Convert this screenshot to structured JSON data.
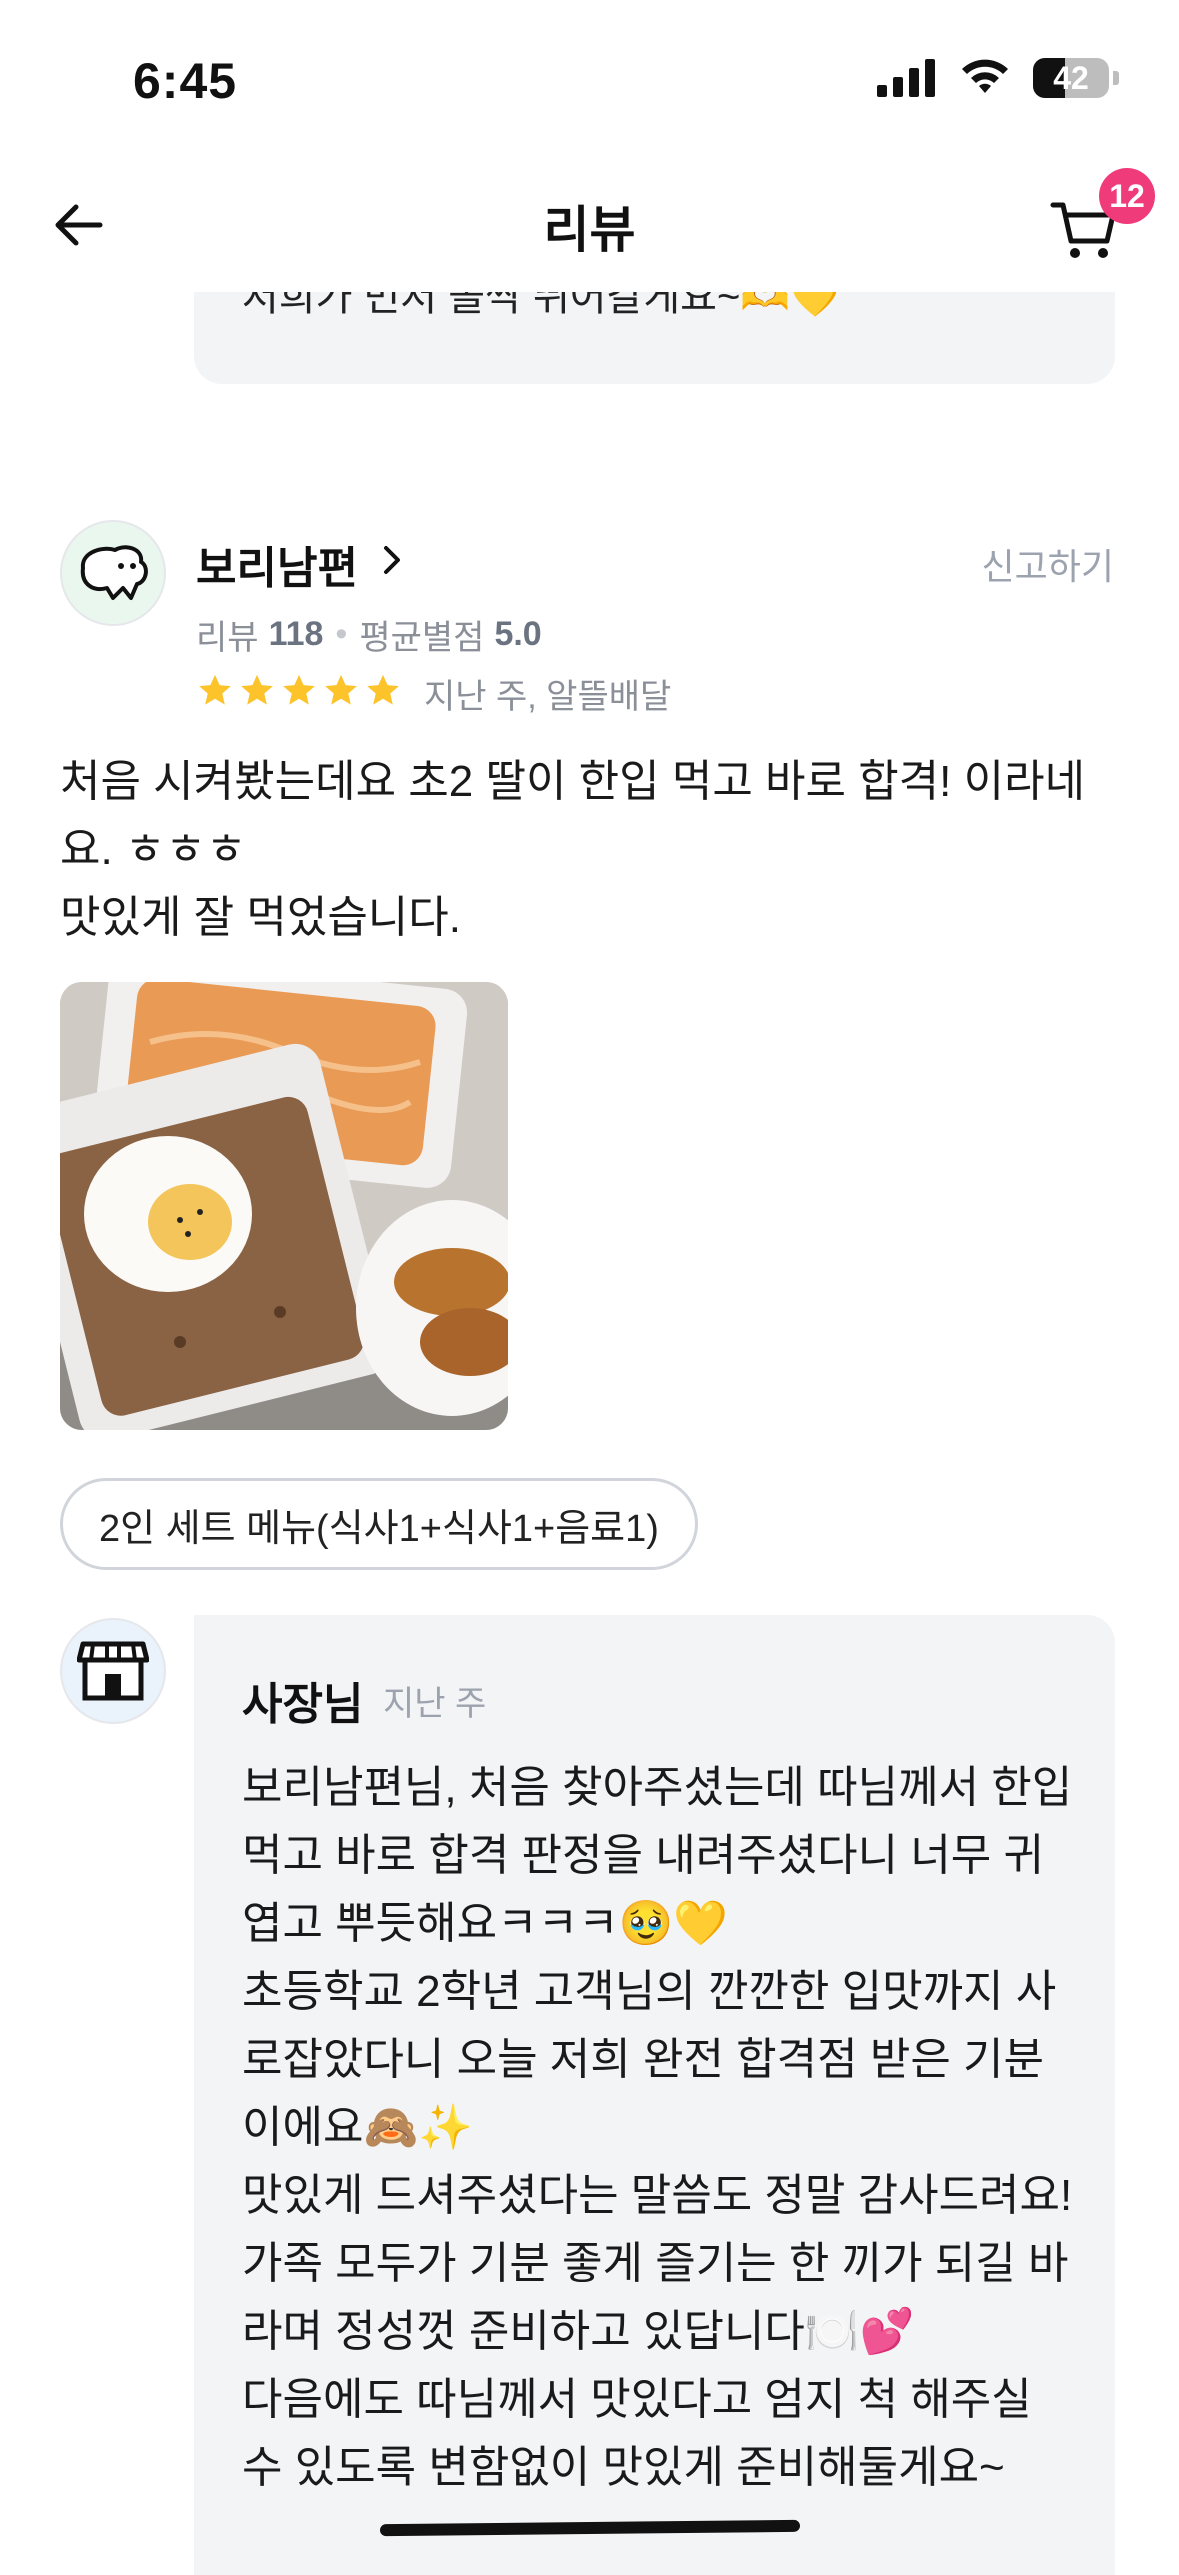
{
  "status_bar": {
    "time": "6:45",
    "battery": "42",
    "battery_level": 0.42
  },
  "nav": {
    "title": "리뷰",
    "cart_badge": "12"
  },
  "previous_reply": {
    "text": "저희가 먼저 쏠싹 뛰어갈게요~🫶💛"
  },
  "review": {
    "reviewer_name": "보리남편",
    "report_label": "신고하기",
    "stats_review_label": "리뷰",
    "stats_review_count": "118",
    "stats_rating_label": "평균별점",
    "stats_rating_value": "5.0",
    "rating": 5,
    "meta": "지난 주, 알뜰배달",
    "text": "처음 시켜봤는데요 초2 딸이 한입 먹고 바로 합격! 이라네요. ㅎㅎㅎ\n맛있게 잘 먹었습니다.",
    "menu_chip": "2인 세트 메뉴(식사1+식사1+음료1)"
  },
  "owner_reply": {
    "name": "사장님",
    "time": "지난 주",
    "text": "보리남편님, 처음 찾아주셨는데 따님께서 한입 먹고 바로 합격 판정을 내려주셨다니 너무 귀엽고 뿌듯해요ㅋㅋㅋ🥹💛\n초등학교 2학년 고객님의 깐깐한 입맛까지 사로잡았다니 오늘 저희 완전 합격점 받은 기분이에요🙈✨\n맛있게 드셔주셨다는 말씀도 정말 감사드려요!\n가족 모두가 기분 좋게 즐기는 한 끼가 되길 바라며 정성껏 준비하고 있답니다🍽️💕\n다음에도 따님께서 맛있다고 엄지 척 해주실 수 있도록 변함없이 맛있게 준비해둘게요~"
  },
  "colors": {
    "star": "#FDC32B",
    "badge": "#F03B7B",
    "card_bg": "#F3F4F6",
    "muted": "#9CA3AF"
  },
  "icons": [
    "back-arrow-icon",
    "cart-icon",
    "chevron-right-icon",
    "star-icon",
    "store-icon",
    "signal-icon",
    "wifi-icon",
    "battery-icon"
  ]
}
